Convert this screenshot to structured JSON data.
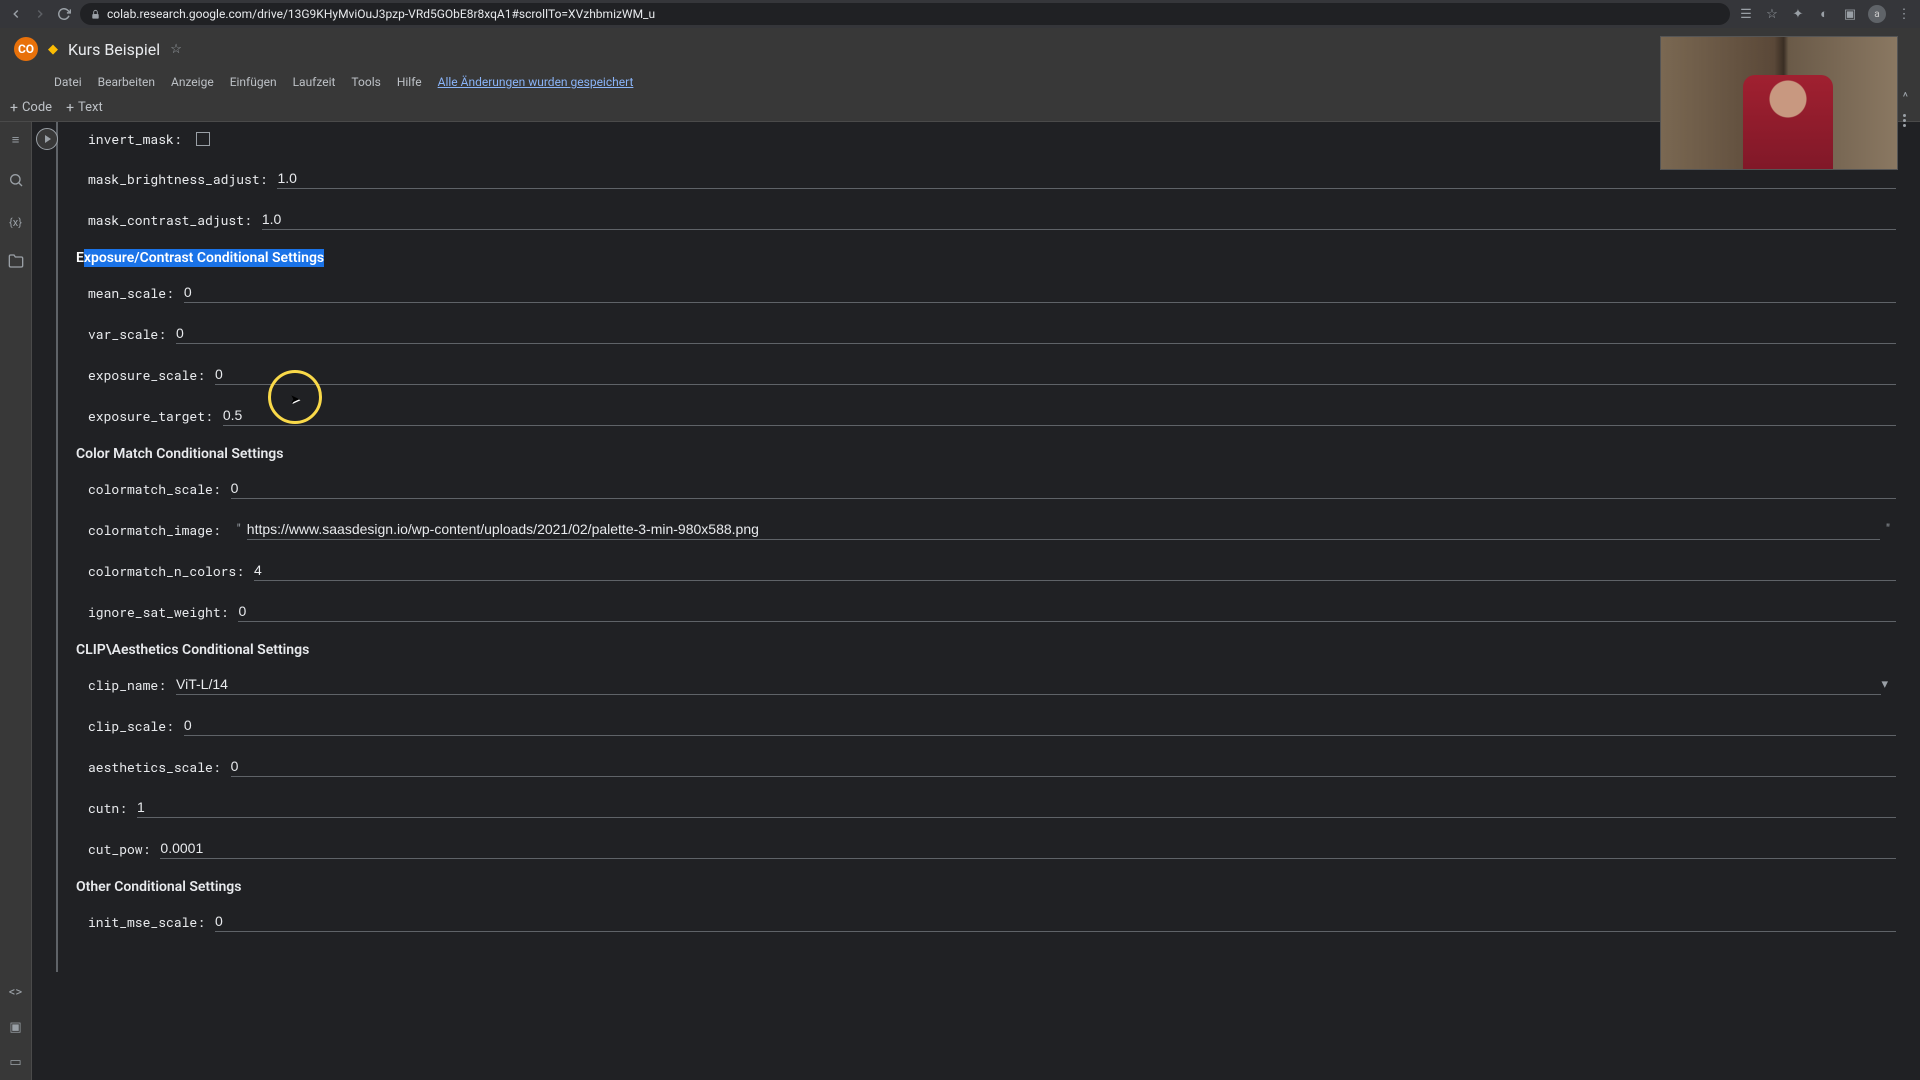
{
  "browser": {
    "url": "colab.research.google.com/drive/13G9KHyMviOuJ3pzp-VRd5GObE8r8xqA1#scrollTo=XVzhbmizWM_u"
  },
  "header": {
    "title": "Kurs Beispiel"
  },
  "menu": {
    "items": [
      "Datei",
      "Bearbeiten",
      "Anzeige",
      "Einfügen",
      "Laufzeit",
      "Tools",
      "Hilfe"
    ],
    "save_status": "Alle Änderungen wurden gespeichert"
  },
  "toolbar": {
    "code": "Code",
    "text": "Text"
  },
  "form": {
    "invert_mask": {
      "label": "invert_mask:"
    },
    "mask_brightness_adjust": {
      "label": "mask_brightness_adjust:",
      "value": "1.0"
    },
    "mask_contrast_adjust": {
      "label": "mask_contrast_adjust:",
      "value": "1.0"
    },
    "section_exposure": "Exposure/Contrast Conditional Settings",
    "mean_scale": {
      "label": "mean_scale:",
      "value": "0"
    },
    "var_scale": {
      "label": "var_scale:",
      "value": "0"
    },
    "exposure_scale": {
      "label": "exposure_scale:",
      "value": "0"
    },
    "exposure_target": {
      "label": "exposure_target:",
      "value": "0.5"
    },
    "section_color": "Color Match Conditional Settings",
    "colormatch_scale": {
      "label": "colormatch_scale:",
      "value": "0"
    },
    "colormatch_image": {
      "label": "colormatch_image:",
      "value": "https://www.saasdesign.io/wp-content/uploads/2021/02/palette-3-min-980x588.png"
    },
    "colormatch_n_colors": {
      "label": "colormatch_n_colors:",
      "value": "4"
    },
    "ignore_sat_weight": {
      "label": "ignore_sat_weight:",
      "value": "0"
    },
    "section_clip": "CLIP\\Aesthetics Conditional Settings",
    "clip_name": {
      "label": "clip_name:",
      "value": "ViT-L/14"
    },
    "clip_scale": {
      "label": "clip_scale:",
      "value": "0"
    },
    "aesthetics_scale": {
      "label": "aesthetics_scale:",
      "value": "0"
    },
    "cutn": {
      "label": "cutn:",
      "value": "1"
    },
    "cut_pow": {
      "label": "cut_pow:",
      "value": "0.0001"
    },
    "section_other": "Other Conditional Settings",
    "init_mse_scale": {
      "label": "init_mse_scale:",
      "value": "0"
    }
  }
}
